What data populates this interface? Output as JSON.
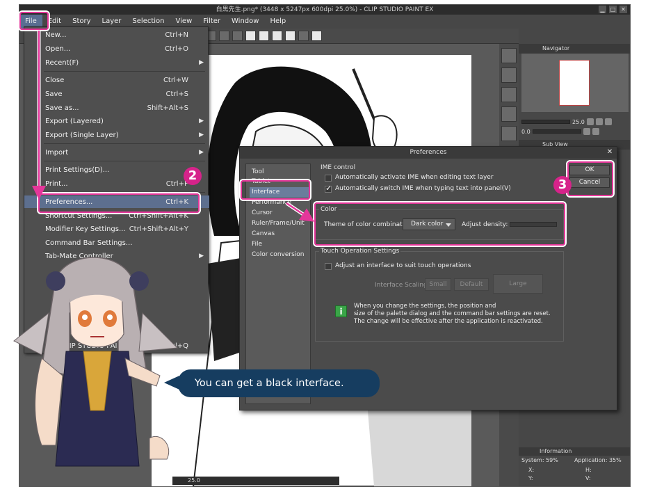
{
  "window": {
    "title": "白黒先生.png* (3448 x 5247px 600dpi 25.0%) - CLIP STUDIO PAINT EX",
    "controls": [
      "minimize",
      "restore",
      "close"
    ]
  },
  "menubar": [
    "File",
    "Edit",
    "Story",
    "Layer",
    "Selection",
    "View",
    "Filter",
    "Window",
    "Help"
  ],
  "file_menu": {
    "items": [
      {
        "label": "New...",
        "shortcut": "Ctrl+N"
      },
      {
        "label": "Open...",
        "shortcut": "Ctrl+O"
      },
      {
        "label": "Recent(F)",
        "shortcut": ""
      },
      {
        "label": "Close",
        "shortcut": "Ctrl+W"
      },
      {
        "label": "Save",
        "shortcut": "Ctrl+S"
      },
      {
        "label": "Save as...",
        "shortcut": "Shift+Alt+S"
      },
      {
        "label": "Export (Layered)",
        "shortcut": ""
      },
      {
        "label": "Export (Single Layer)",
        "shortcut": ""
      },
      {
        "label": "Import",
        "shortcut": ""
      },
      {
        "label": "Print Settings(D)...",
        "shortcut": ""
      },
      {
        "label": "Print...",
        "shortcut": "Ctrl+P"
      },
      {
        "label": "Preferences...",
        "shortcut": "Ctrl+K"
      },
      {
        "label": "Shortcut Settings...",
        "shortcut": "Ctrl+Shift+Alt+K"
      },
      {
        "label": "Modifier Key Settings...",
        "shortcut": "Ctrl+Shift+Alt+Y"
      },
      {
        "label": "Command Bar Settings...",
        "shortcut": ""
      },
      {
        "label": "Tab-Mate Controller",
        "shortcut": ""
      },
      {
        "label": "Exit CLIP STUDIO PAINT",
        "shortcut": "Ctrl+Q"
      }
    ]
  },
  "badges": {
    "step2": "2",
    "step3": "3"
  },
  "preferences": {
    "title": "Preferences",
    "categories": [
      "Tool",
      "Tablet",
      "Interface",
      "Performance",
      "Cursor",
      "Ruler/Frame/Unit",
      "Canvas",
      "File",
      "Color conversion"
    ],
    "selected_category": "Interface",
    "ok_label": "OK",
    "cancel_label": "Cancel",
    "ime_group": "IME control",
    "ime_auto_activate": "Automatically activate IME when editing text layer",
    "ime_auto_switch": "Automatically switch IME when typing text into panel(V)",
    "color_group": "Color",
    "theme_label": "Theme of color combination:",
    "theme_value": "Dark color",
    "density_label": "Adjust density:",
    "touch_group": "Touch Operation Settings",
    "touch_adjust": "Adjust an interface to suit touch operations",
    "scaling_label": "Interface Scaling:",
    "scaling_small": "Small",
    "scaling_default": "Default",
    "scaling_large": "Large",
    "note_lines": [
      "When you change the settings, the position and",
      "size of the palette dialog and the command bar settings are reset.",
      "The change will be effective after the application is reactivated."
    ]
  },
  "navigator": {
    "tab": "Navigator",
    "zoom": "25.0",
    "rotation": "0.0",
    "sub_view_tab": "Sub View"
  },
  "information": {
    "tab": "Information",
    "system": "System: 59%",
    "application": "Application: 35%",
    "x_label": "X:",
    "y_label": "Y:",
    "h_label": "H:",
    "v_label": "V:"
  },
  "status_bar": {
    "zoom": "25.0"
  },
  "bubble_text": "You can get a black interface.",
  "colors": {
    "callout": "#e5369a",
    "bubble": "#163d60",
    "menu_highlight": "#5d6f8f"
  }
}
